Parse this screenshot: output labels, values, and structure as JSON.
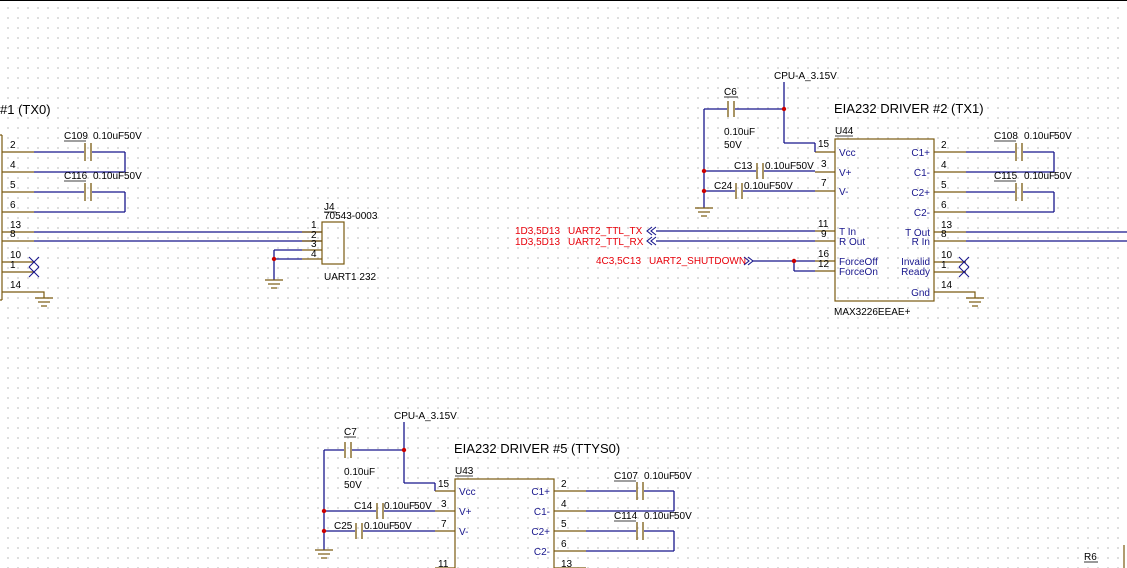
{
  "drivers": {
    "left_title": "#1 (TX0)",
    "d2_title": "EIA232 DRIVER #2 (TX1)",
    "d5_title": "EIA232 DRIVER #5 (TTYS0)"
  },
  "power": {
    "net": "CPU-A_3.15V"
  },
  "u44": {
    "ref": "U44",
    "part": "MAX3226EEAE+",
    "left_pins": [
      {
        "num": "15",
        "name": "Vcc"
      },
      {
        "num": "3",
        "name": "V+"
      },
      {
        "num": "7",
        "name": "V-"
      },
      {
        "num": "11",
        "name": "T In"
      },
      {
        "num": "9",
        "name": "R Out"
      },
      {
        "num": "16",
        "name": "ForceOff"
      },
      {
        "num": "12",
        "name": "ForceOn"
      }
    ],
    "right_pins": [
      {
        "num": "2",
        "name": "C1+"
      },
      {
        "num": "4",
        "name": "C1-"
      },
      {
        "num": "5",
        "name": "C2+"
      },
      {
        "num": "6",
        "name": "C2-"
      },
      {
        "num": "13",
        "name": "T Out"
      },
      {
        "num": "8",
        "name": "R In"
      },
      {
        "num": "10",
        "name": "Invalid"
      },
      {
        "num": "1",
        "name": "Ready"
      },
      {
        "num": "14",
        "name": "Gnd"
      }
    ]
  },
  "u43": {
    "ref": "U43",
    "left_pins": [
      {
        "num": "15",
        "name": "Vcc"
      },
      {
        "num": "3",
        "name": "V+"
      },
      {
        "num": "7",
        "name": "V-"
      },
      {
        "num": "11",
        "name": ""
      }
    ],
    "right_pins": [
      {
        "num": "2",
        "name": "C1+"
      },
      {
        "num": "4",
        "name": "C1-"
      },
      {
        "num": "5",
        "name": "C2+"
      },
      {
        "num": "6",
        "name": "C2-"
      },
      {
        "num": "13",
        "name": ""
      }
    ]
  },
  "u_left": {
    "pins": [
      "2",
      "4",
      "5",
      "6",
      "13",
      "8",
      "10",
      "1",
      "14"
    ]
  },
  "j4": {
    "ref": "J4",
    "part": "70543-0003",
    "label": "UART1 232",
    "pins": [
      "1",
      "2",
      "3",
      "4"
    ]
  },
  "capacitors": [
    {
      "ref": "C109",
      "value": "0.10uF",
      "voltage": "50V"
    },
    {
      "ref": "C116",
      "value": "0.10uF",
      "voltage": "50V"
    },
    {
      "ref": "C6",
      "value": "0.10uF",
      "voltage": "50V"
    },
    {
      "ref": "C13",
      "value": "0.10uF",
      "voltage": "50V"
    },
    {
      "ref": "C24",
      "value": "0.10uF",
      "voltage": "50V"
    },
    {
      "ref": "C108",
      "value": "0.10uF",
      "voltage": "50V"
    },
    {
      "ref": "C115",
      "value": "0.10uF",
      "voltage": "50V"
    },
    {
      "ref": "C7",
      "value": "0.10uF",
      "voltage": "50V"
    },
    {
      "ref": "C14",
      "value": "0.10uF",
      "voltage": "50V"
    },
    {
      "ref": "C25",
      "value": "0.10uF",
      "voltage": "50V"
    },
    {
      "ref": "C107",
      "value": "0.10uF",
      "voltage": "50V"
    },
    {
      "ref": "C114",
      "value": "0.10uF",
      "voltage": "50V"
    }
  ],
  "nets": {
    "tx_ref": "1D3,5D13",
    "tx_name": "UART2_TTL_TX",
    "rx_ref": "1D3,5D13",
    "rx_name": "UART2_TTL_RX",
    "sd_ref": "4C3,5C13",
    "sd_name": "UART2_SHUTDOWN"
  },
  "resistor": {
    "ref": "R6"
  },
  "colors": {
    "wire": "#18168c",
    "pin": "#7a5a10",
    "junction": "#cc0000",
    "net_label": "#e8000a"
  }
}
